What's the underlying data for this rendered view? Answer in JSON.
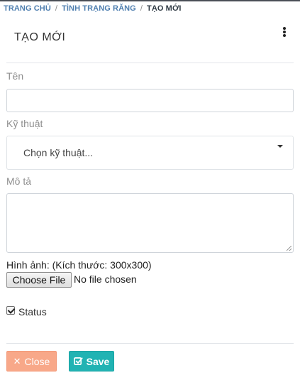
{
  "breadcrumb": {
    "items": [
      "TRANG CHỦ",
      "TÌNH TRẠNG RĂNG"
    ],
    "current": "TẠO MỚI",
    "separator": "/"
  },
  "header": {
    "title": "TẠO MỚI",
    "menu_icon": "more-vertical-icon"
  },
  "form": {
    "name_label": "Tên",
    "name_value": "",
    "technique_label": "Kỹ thuật",
    "technique_selected": "Chọn kỹ thuật...",
    "description_label": "Mô tả",
    "description_value": "",
    "image_label": "Hình ảnh: (Kích thước: 300x300)",
    "file_button": "Choose File",
    "file_status": "No file chosen",
    "status_label": "Status",
    "status_checked": true
  },
  "actions": {
    "close_label": "Close",
    "close_icon": "close-icon",
    "save_label": "Save",
    "save_icon": "check-square-icon"
  },
  "colors": {
    "breadcrumb_link": "#4f7fb0",
    "close_button": "#f8a889",
    "save_button": "#21b3b3"
  }
}
